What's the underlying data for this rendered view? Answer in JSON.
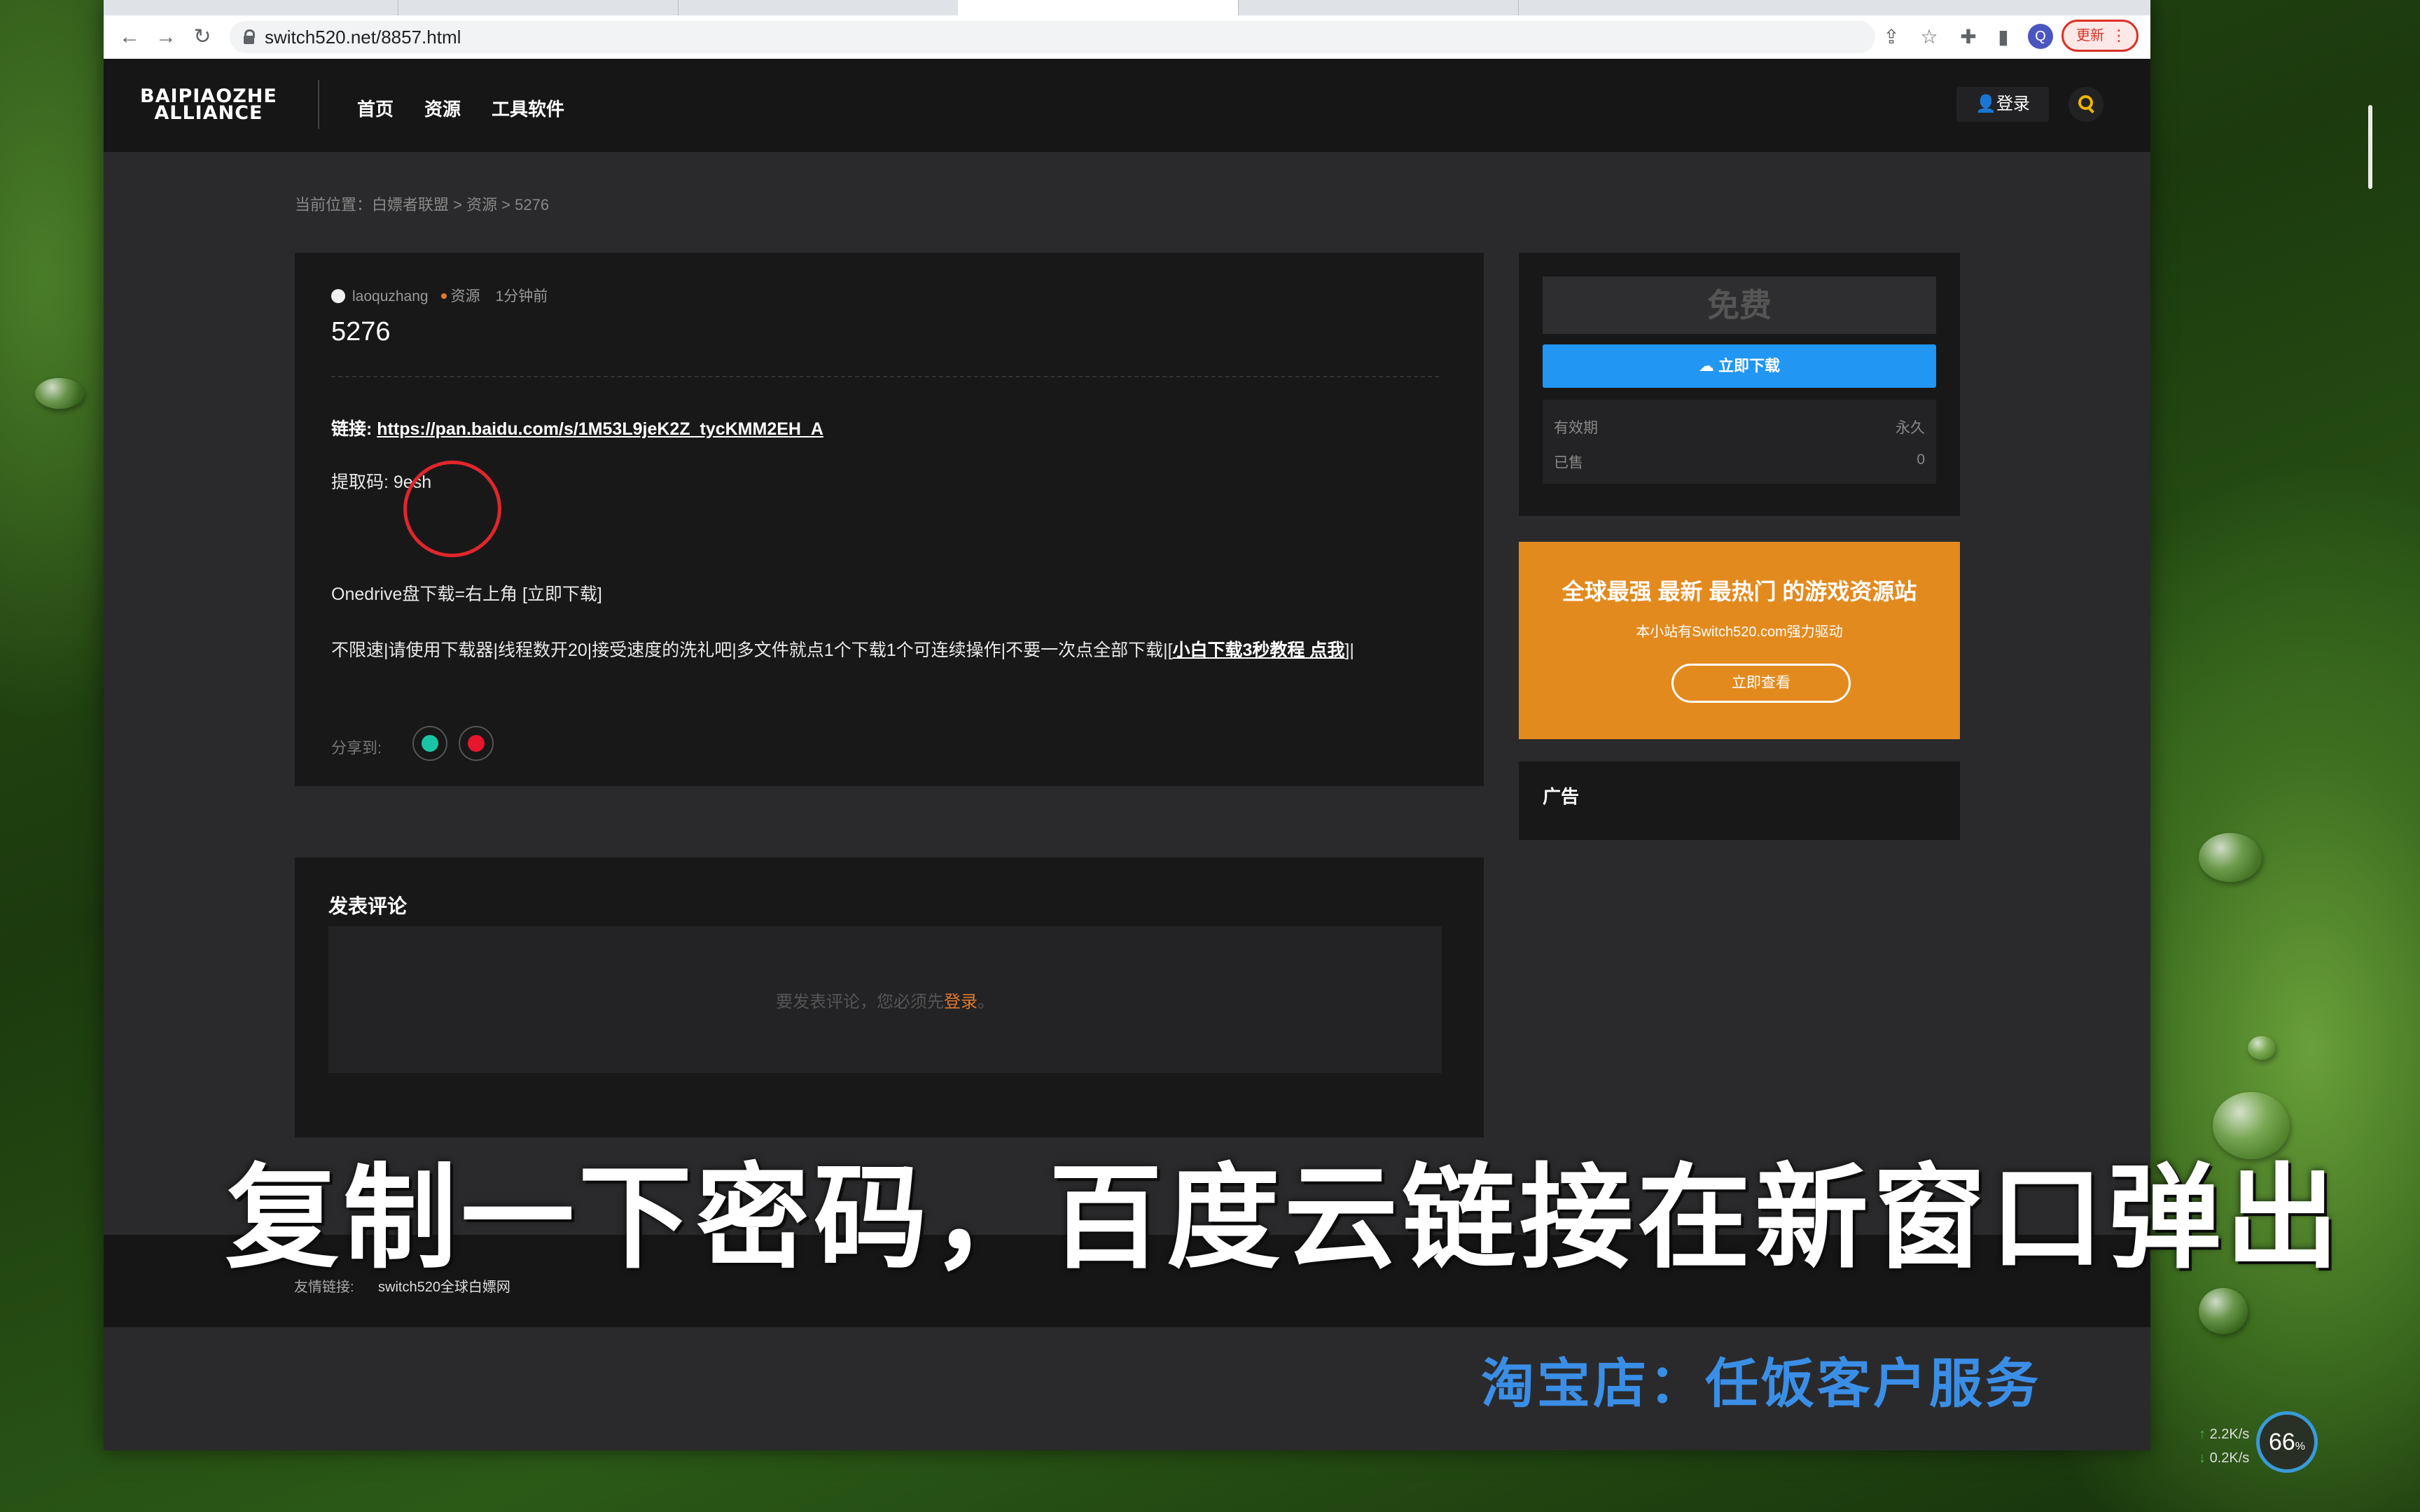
{
  "browser": {
    "url": "switch520.net/8857.html",
    "update_label": "更新",
    "profile_initial": "Q"
  },
  "site": {
    "logo_line1": "BAIPIAOZHE",
    "logo_line2": "ALLIANCE",
    "nav": [
      "首页",
      "资源",
      "工具软件"
    ],
    "login_label": "登录"
  },
  "breadcrumb": "当前位置：白嫖者联盟 > 资源 > 5276",
  "post": {
    "author": "laoquzhang",
    "category": "资源",
    "time": "1分钟前",
    "title": "5276",
    "link_label": "链接: ",
    "link_url": "https://pan.baidu.com/s/1M53L9jeK2Z_tycKMM2EH_A",
    "code_line": "提取码: 9esh",
    "onedrive_line": "Onedrive盘下载=右上角 [立即下载]",
    "tip_line": "不限速|请使用下载器|线程数开20|接受速度的洗礼吧|多文件就点1个下载1个可连续操作|不要一次点全部下载|[",
    "tip_link": "小白下载3秒教程 点我",
    "tip_end": "]|",
    "share_label": "分享到:"
  },
  "comments": {
    "title": "发表评论",
    "hint_prefix": "要发表评论，您必须先",
    "hint_link": "登录",
    "hint_suffix": "。"
  },
  "sidebar": {
    "price": "免费",
    "download_label": "立即下载",
    "rows": [
      {
        "label": "有效期",
        "value": "永久"
      },
      {
        "label": "已售",
        "value": "0"
      }
    ],
    "promo_title": "全球最强 最新 最热门 的游戏资源站",
    "promo_sub": "本小站有Switch520.com强力驱动",
    "promo_button": "立即查看",
    "ad_title": "广告"
  },
  "footer": {
    "friend_label": "友情链接:",
    "friend_link": "switch520全球白嫖网"
  },
  "overlay": {
    "subtitle": "复制一下密码，百度云链接在新窗口弹出",
    "taobao": "淘宝店：任饭客户服务"
  },
  "netwidget": {
    "up": "2.2",
    "down": "0.2",
    "unit": "K/s",
    "percent": "66",
    "percent_unit": "%"
  }
}
